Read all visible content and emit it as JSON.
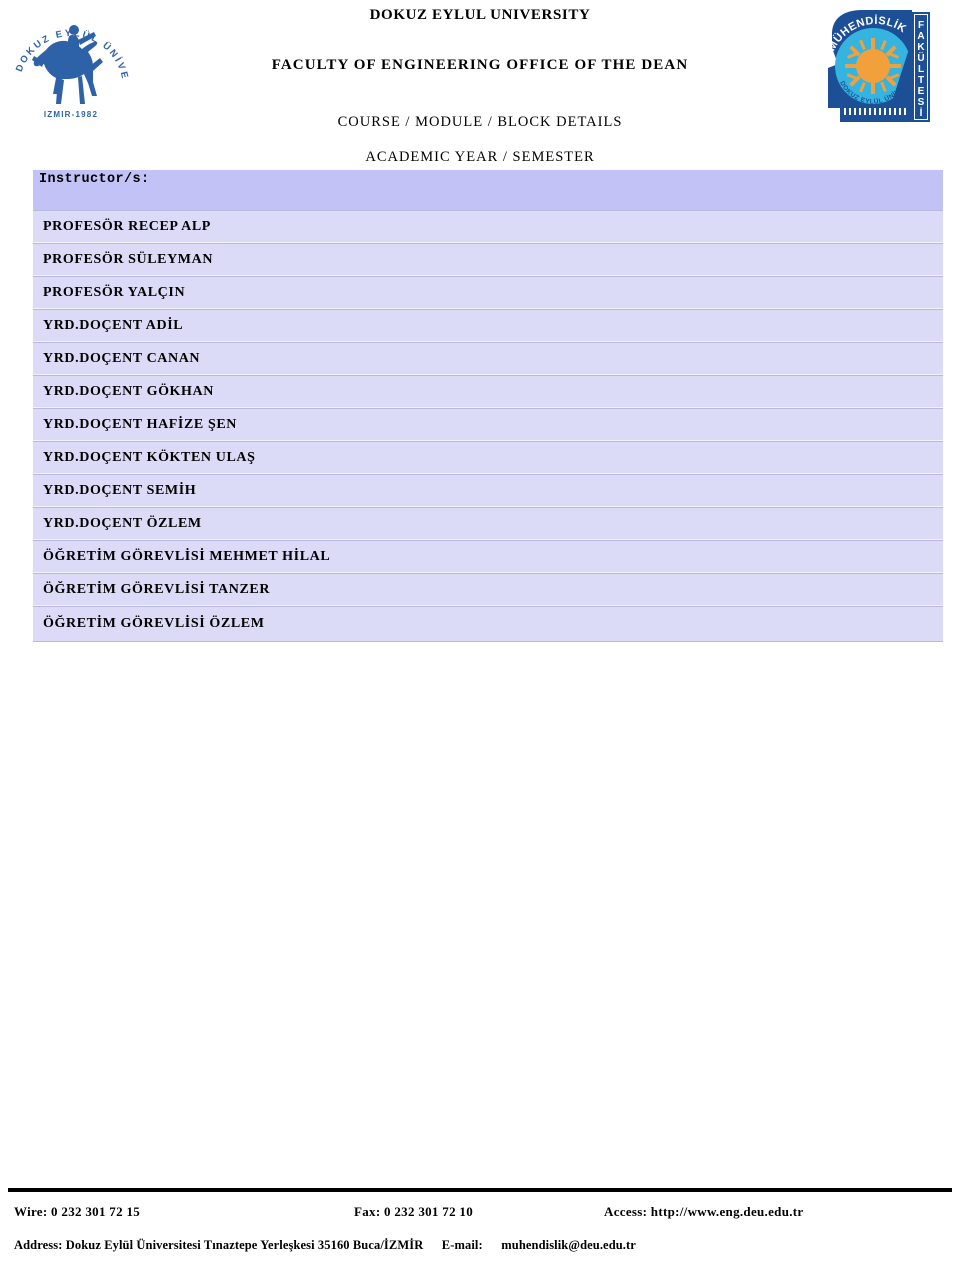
{
  "header": {
    "university": "DOKUZ EYLUL UNIVERSITY",
    "faculty": "FACULTY OF ENGINEERING OFFICE OF THE DEAN",
    "course_details": "COURSE / MODULE / BLOCK DETAILS",
    "academic_year": "ACADEMIC YEAR / SEMESTER",
    "logo_left": {
      "name": "dokuz-eylul-university-seal",
      "arc_text": "DOKUZ EYLÜL ÜNİVERSİTESİ",
      "bottom_text": "IZMIR-1982",
      "color": "#2e62a8"
    },
    "logo_right": {
      "name": "engineering-faculty-seal",
      "arc_text": "MÜHENDİSLİK",
      "inner_arc_text": "DOKUZ EYLÜL ÜNİVERSİTESİ",
      "side_text": "FAKÜLTESİ",
      "color_dark": "#1d4f96",
      "color_cyan": "#35b4e0",
      "color_sun": "#f2a03c"
    }
  },
  "table": {
    "header_label": "Instructor/s:",
    "rows": [
      {
        "name": "PROFESÖR RECEP ALP"
      },
      {
        "name": "PROFESÖR SÜLEYMAN"
      },
      {
        "name": "PROFESÖR YALÇIN"
      },
      {
        "name": "YRD.DOÇENT ADİL"
      },
      {
        "name": "YRD.DOÇENT CANAN"
      },
      {
        "name": "YRD.DOÇENT GÖKHAN"
      },
      {
        "name": "YRD.DOÇENT HAFİZE ŞEN"
      },
      {
        "name": "YRD.DOÇENT KÖKTEN ULAŞ"
      },
      {
        "name": "YRD.DOÇENT SEMİH"
      },
      {
        "name": "YRD.DOÇENT ÖZLEM"
      },
      {
        "name": "ÖĞRETİM GÖREVLİSİ MEHMET HİLAL"
      },
      {
        "name": "ÖĞRETİM GÖREVLİSİ TANZER"
      },
      {
        "name": "ÖĞRETİM GÖREVLİSİ ÖZLEM"
      }
    ],
    "colors": {
      "header_bg": "#c2c2f7",
      "row_bg": "#dbdbf7",
      "border": "#b9b9e0"
    }
  },
  "footer": {
    "wire": "Wire: 0 232 301 72 15",
    "fax": "Fax: 0 232 301 72 10",
    "access": "Access: http://www.eng.deu.edu.tr",
    "address_label": "Address:",
    "address_value": "Dokuz Eylül Üniversitesi Tınaztepe Yerleşkesi 35160 Buca/İZMİR",
    "email_label": "E-mail:",
    "email_value": "muhendislik@deu.edu.tr"
  }
}
